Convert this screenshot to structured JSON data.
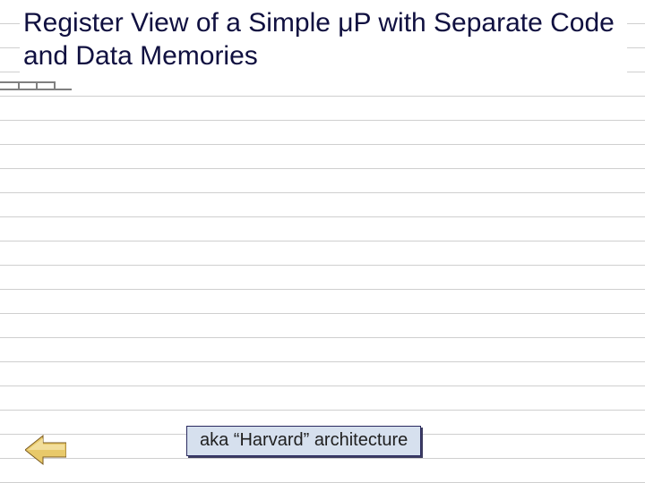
{
  "title": "Register View of a Simple μP with Separate Code and Data Memories",
  "caption": "aka “Harvard” architecture",
  "icons": {
    "back": "back-arrow-icon"
  }
}
